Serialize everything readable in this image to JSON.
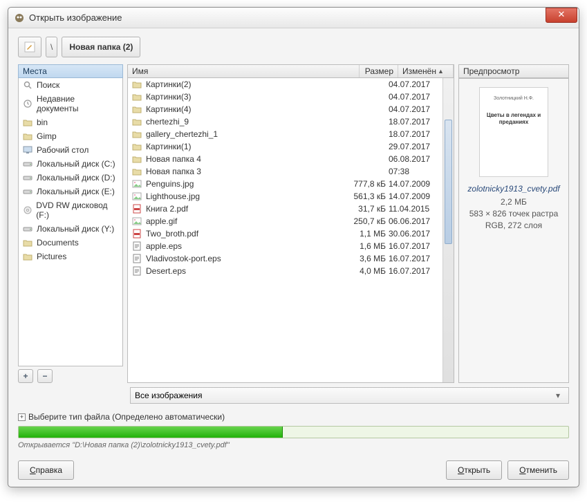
{
  "window": {
    "title": "Открыть изображение"
  },
  "toolbar": {
    "path_current": "Новая папка (2)",
    "path_sep": "\\"
  },
  "places": {
    "header": "Места",
    "items": [
      {
        "label": "Поиск",
        "icon": "search-icon"
      },
      {
        "label": "Недавние документы",
        "icon": "clock-icon"
      },
      {
        "label": "bin",
        "icon": "folder-icon"
      },
      {
        "label": "Gimp",
        "icon": "folder-icon"
      },
      {
        "label": "Рабочий стол",
        "icon": "desktop-icon"
      },
      {
        "label": "Локальный диск (C:)",
        "icon": "drive-icon"
      },
      {
        "label": "Локальный диск (D:)",
        "icon": "drive-icon"
      },
      {
        "label": "Локальный диск (E:)",
        "icon": "drive-icon"
      },
      {
        "label": "DVD RW дисковод (F:)",
        "icon": "disc-icon"
      },
      {
        "label": "Локальный диск (Y:)",
        "icon": "drive-icon"
      },
      {
        "label": "Documents",
        "icon": "folder-icon"
      },
      {
        "label": "Pictures",
        "icon": "folder-icon"
      }
    ]
  },
  "filelist": {
    "headers": {
      "name": "Имя",
      "size": "Размер",
      "modified": "Изменён"
    },
    "rows": [
      {
        "icon": "folder-icon",
        "name": "Картинки(2)",
        "size": "",
        "date": "04.07.2017"
      },
      {
        "icon": "folder-icon",
        "name": "Картинки(3)",
        "size": "",
        "date": "04.07.2017"
      },
      {
        "icon": "folder-icon",
        "name": "Картинки(4)",
        "size": "",
        "date": "04.07.2017"
      },
      {
        "icon": "folder-icon",
        "name": "chertezhi_9",
        "size": "",
        "date": "18.07.2017"
      },
      {
        "icon": "folder-icon",
        "name": "gallery_chertezhi_1",
        "size": "",
        "date": "18.07.2017"
      },
      {
        "icon": "folder-icon",
        "name": "Картинки(1)",
        "size": "",
        "date": "29.07.2017"
      },
      {
        "icon": "folder-icon",
        "name": "Новая папка 4",
        "size": "",
        "date": "06.08.2017"
      },
      {
        "icon": "folder-icon",
        "name": "Новая папка 3",
        "size": "",
        "date": "07:38"
      },
      {
        "icon": "image-icon",
        "name": "Penguins.jpg",
        "size": "777,8 кБ",
        "date": "14.07.2009"
      },
      {
        "icon": "image-icon",
        "name": "Lighthouse.jpg",
        "size": "561,3 кБ",
        "date": "14.07.2009"
      },
      {
        "icon": "pdf-icon",
        "name": "Книга 2.pdf",
        "size": "31,7 кБ",
        "date": "11.04.2015"
      },
      {
        "icon": "image-icon",
        "name": "apple.gif",
        "size": "250,7 кБ",
        "date": "06.06.2017"
      },
      {
        "icon": "pdf-icon",
        "name": "Two_broth.pdf",
        "size": "1,1 МБ",
        "date": "30.06.2017"
      },
      {
        "icon": "eps-icon",
        "name": "apple.eps",
        "size": "1,6 МБ",
        "date": "16.07.2017"
      },
      {
        "icon": "eps-icon",
        "name": "Vladivostok-port.eps",
        "size": "3,6 МБ",
        "date": "16.07.2017"
      },
      {
        "icon": "eps-icon",
        "name": "Desert.eps",
        "size": "4,0 МБ",
        "date": "16.07.2017"
      }
    ]
  },
  "preview": {
    "header": "Предпросмотр",
    "thumb_line1": "Золотницкий Н.Ф.",
    "thumb_title": "Цветы в легендах и преданиях",
    "filename": "zolotnicky1913_cvety.pdf",
    "meta1": "2,2 МБ",
    "meta2": "583 × 826 точек растра",
    "meta3": "RGB, 272 слоя"
  },
  "filter": {
    "label": "Все изображения"
  },
  "filetype": {
    "label": "Выберите тип файла (Определено автоматически)"
  },
  "progress": {
    "percent": 48
  },
  "status": {
    "text": "Открывается \"D:\\Новая папка (2)\\zolotnicky1913_cvety.pdf\""
  },
  "buttons": {
    "help_u": "С",
    "help_rest": "правка",
    "open_u": "О",
    "open_rest": "ткрыть",
    "cancel_u": "О",
    "cancel_rest": "тменить"
  }
}
